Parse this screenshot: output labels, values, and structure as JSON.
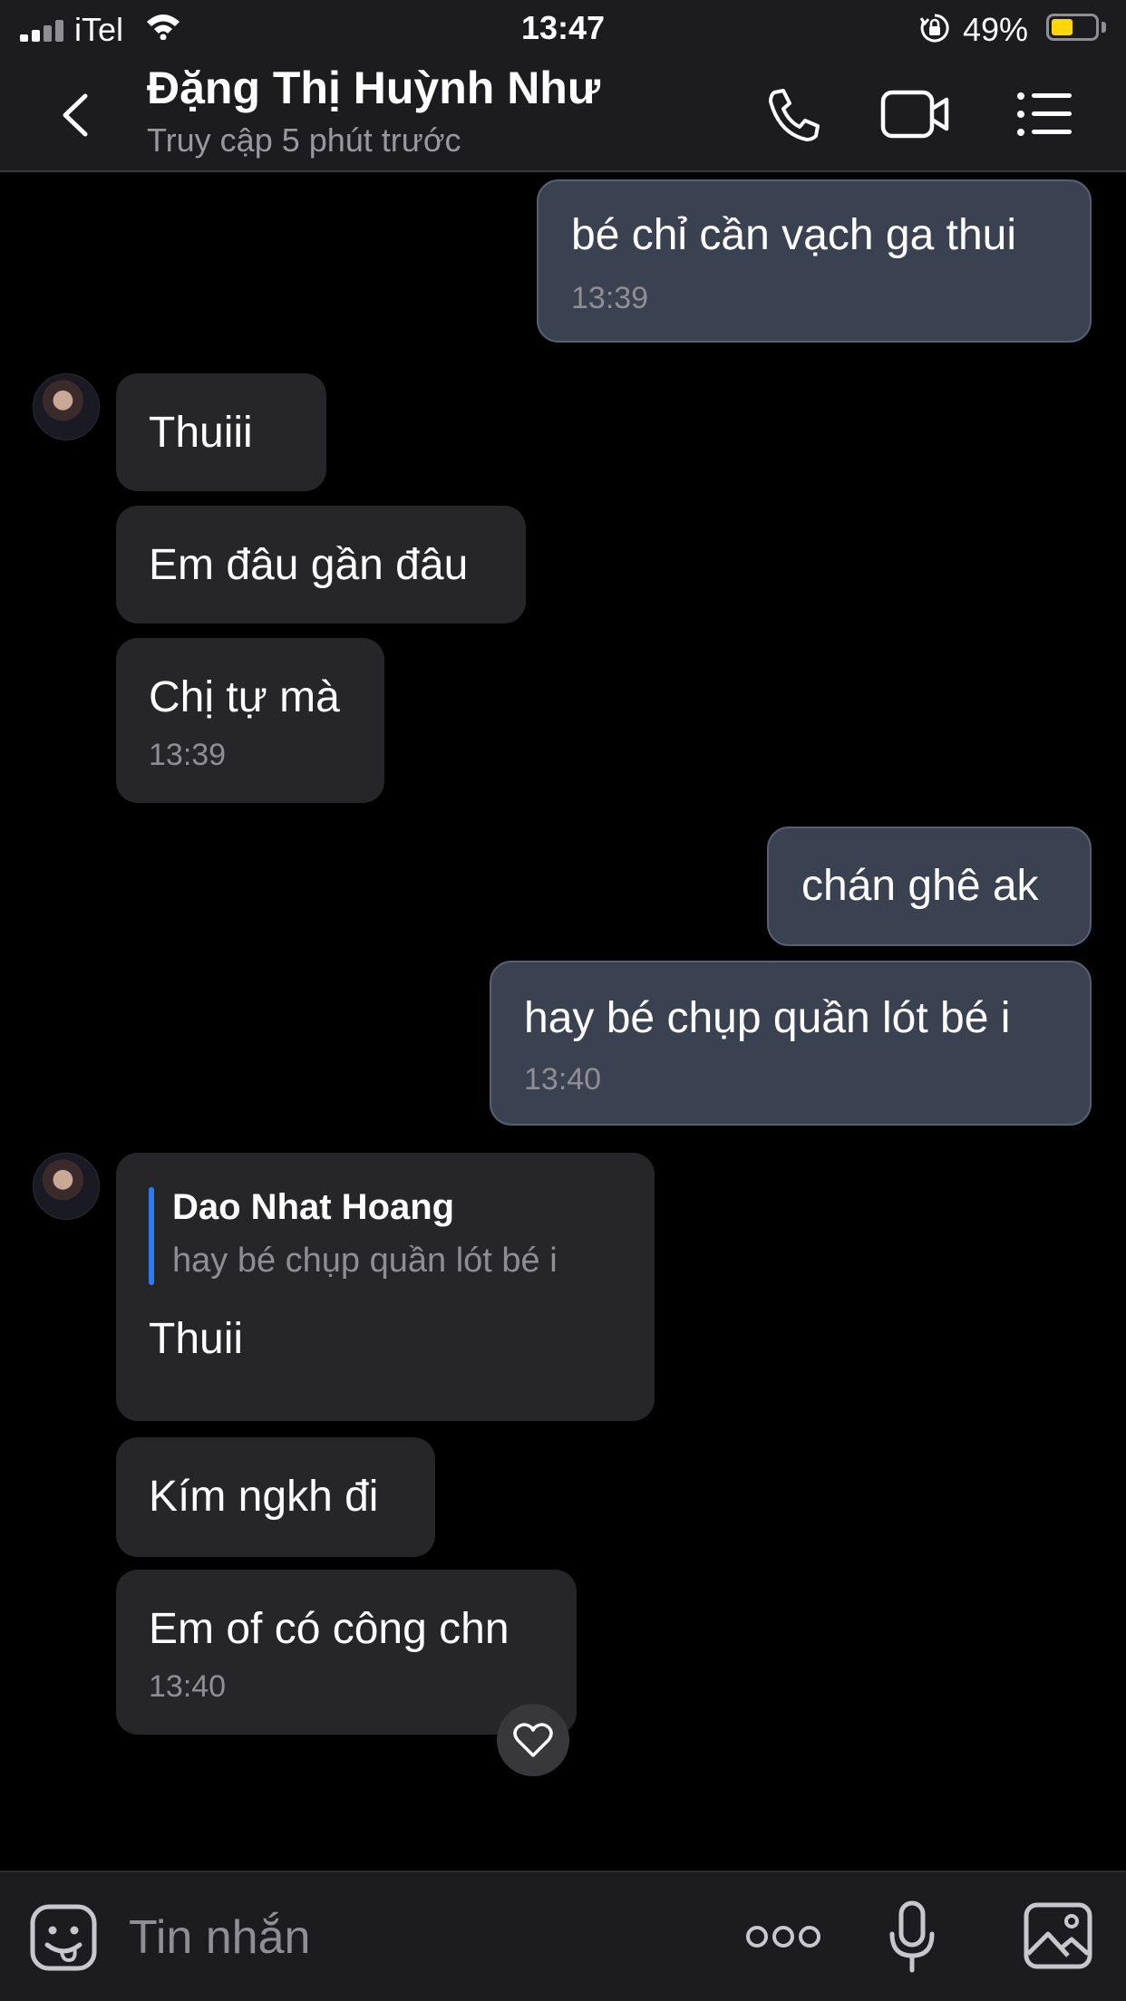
{
  "status_bar": {
    "carrier": "iTel",
    "time": "13:47",
    "battery_percent": "49%",
    "battery_level": 0.49,
    "battery_color": "#ffd60a"
  },
  "header": {
    "contact_name": "Đặng Thị Huỳnh Như",
    "presence": "Truy cập 5 phút trước",
    "icons": [
      "back-icon",
      "phone-icon",
      "video-icon",
      "menu-icon"
    ]
  },
  "messages": [
    {
      "side": "out",
      "text": "bé chỉ cần vạch ga thui",
      "time": "13:39"
    },
    {
      "side": "in",
      "text": "Thuiii"
    },
    {
      "side": "in",
      "text": "Em đâu gần đâu"
    },
    {
      "side": "in",
      "text": "Chị tự mà",
      "time": "13:39"
    },
    {
      "side": "out",
      "text": "chán ghê ak"
    },
    {
      "side": "out",
      "text": "hay bé chụp quần lót bé i",
      "time": "13:40"
    },
    {
      "side": "in",
      "quote": {
        "author": "Dao Nhat Hoang",
        "text": "hay bé chụp quần lót bé i"
      },
      "text": "Thuii"
    },
    {
      "side": "in",
      "text": "Kím ngkh đi"
    },
    {
      "side": "in",
      "text": "Em of có công chn",
      "time": "13:40"
    }
  ],
  "input": {
    "placeholder": "Tin nhắn",
    "icons": [
      "sticker-icon",
      "more-icon",
      "microphone-icon",
      "image-icon"
    ]
  },
  "colors": {
    "outgoing_bubble": "#3a4252",
    "incoming_bubble": "#262628",
    "quote_accent": "#2f7bf6",
    "background": "#000000"
  }
}
